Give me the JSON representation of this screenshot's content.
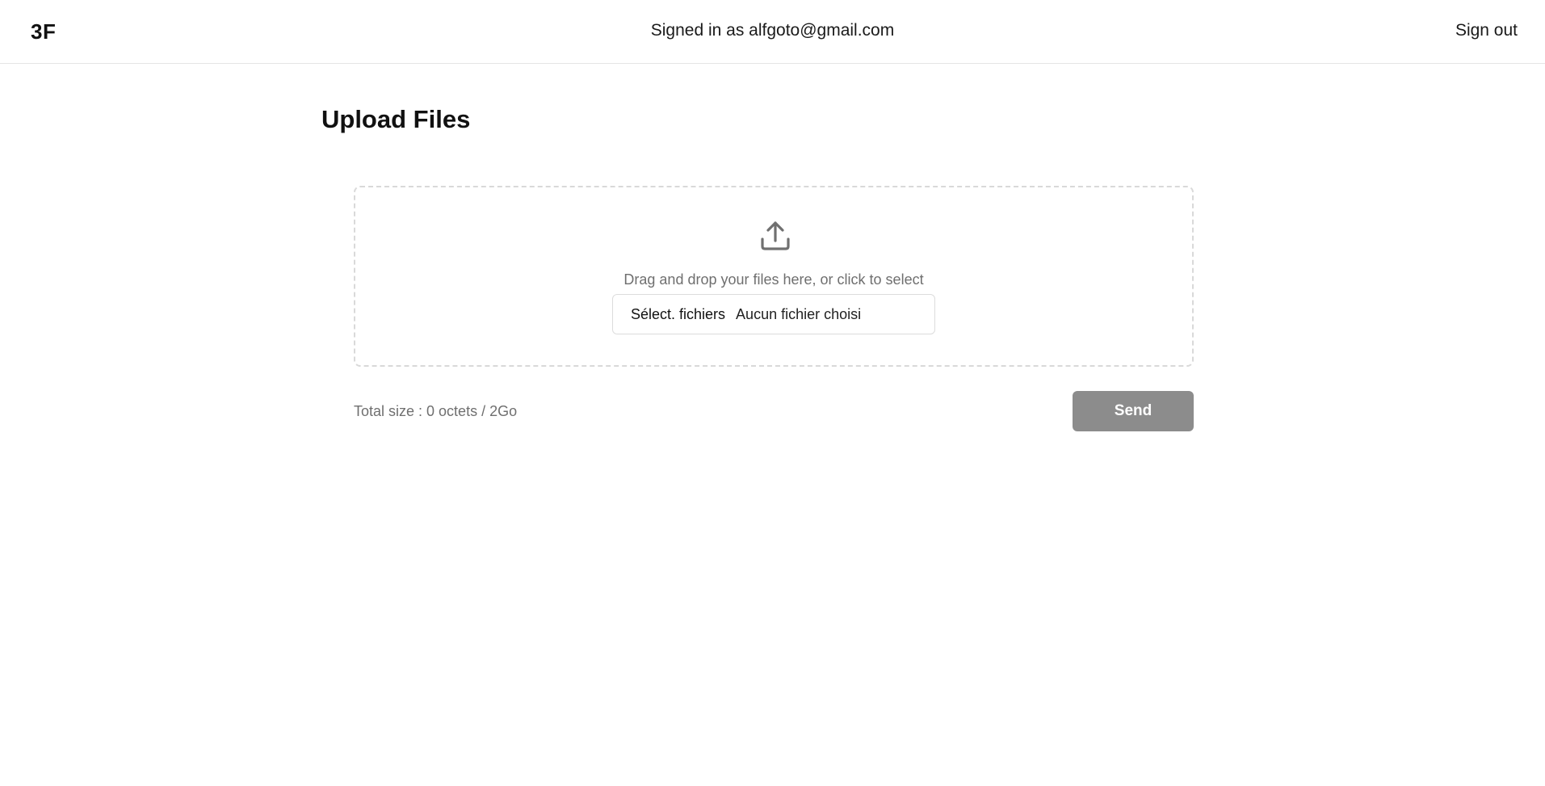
{
  "header": {
    "logo": "3F",
    "signed_in_text": "Signed in as alfgoto@gmail.com",
    "sign_out_label": "Sign out"
  },
  "main": {
    "title": "Upload Files",
    "dropzone": {
      "icon": "upload-icon",
      "instruction": "Drag and drop your files here, or click to select",
      "file_button_label": "Sélect. fichiers",
      "file_status": "Aucun fichier choisi"
    },
    "total_size": "Total size : 0 octets / 2Go",
    "send_label": "Send"
  },
  "colors": {
    "send_button_bg": "#8c8c8c",
    "muted_text": "#6f6f6f",
    "border": "#d9d9d9"
  }
}
